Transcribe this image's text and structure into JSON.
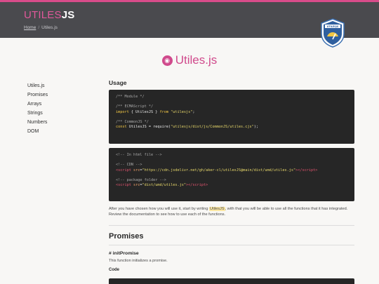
{
  "header": {
    "brand_part1": "UTILES",
    "brand_part2": "JS",
    "breadcrumb_home": "Home",
    "breadcrumb_sep": "/",
    "breadcrumb_current": "Utiles.js",
    "badge_text": "UTILESJS"
  },
  "hero": {
    "title": "Utiles.js"
  },
  "sidebar": {
    "items": [
      {
        "label": "Utiles.js"
      },
      {
        "label": "Promises"
      },
      {
        "label": "Arrays"
      },
      {
        "label": "Strings"
      },
      {
        "label": "Numbers"
      },
      {
        "label": "DOM"
      }
    ]
  },
  "main": {
    "usage_heading": "Usage",
    "code1": {
      "c1": "/** Module */",
      "c2": "/** ECMAScript */",
      "l3_kw1": "import",
      "l3_mid": " { UtilesJS } ",
      "l3_kw2": "from",
      "l3_str": " \"utilesjs\"",
      "l3_end": ";",
      "c4": "/** CommonJS */",
      "l5_kw": "const",
      "l5_mid": " UtilesJS = require(",
      "l5_str": "\"utilesjs/dist/js/CommonJS/utiles.cjs\"",
      "l5_end": ");"
    },
    "code2": {
      "c1": "<!-- In html file -->",
      "c2": "<!-- CDN -->",
      "l3_open": "<script",
      "l3_attr": " src",
      "l3_eq": "=",
      "l3_str": "\"https://cdn.jsdelivr.net/gh/aker-cl/utilesJS@main/dist/umd/utiles.js\"",
      "l3_close": "></",
      "l3_end": "script>",
      "c4": "<!-- package folder -->",
      "l5_open": "<script",
      "l5_attr": " src",
      "l5_eq": "=",
      "l5_str": "\"dist/umd/utiles.js\"",
      "l5_close": "></",
      "l5_end": "script>"
    },
    "para_before": "After you have chosen how you will use it, start by writing ",
    "para_highlight": "UtilesJS",
    "para_after": ", with that you will be able to use all the functions that it has integrated. Review the documentation to see how to use each of the functions.",
    "promises_heading": "Promises",
    "fn_heading": "# initPromise",
    "fn_desc": "This function initializes a promise.",
    "code_heading": "Code"
  },
  "colors": {
    "accent": "#d94c8a",
    "header_bg": "#4a4a4e",
    "code_bg": "#262626",
    "page_bg": "#f8f7f5"
  },
  "icons": {
    "hero_icon": "speedometer-icon",
    "badge": "shield-badge-icon"
  }
}
